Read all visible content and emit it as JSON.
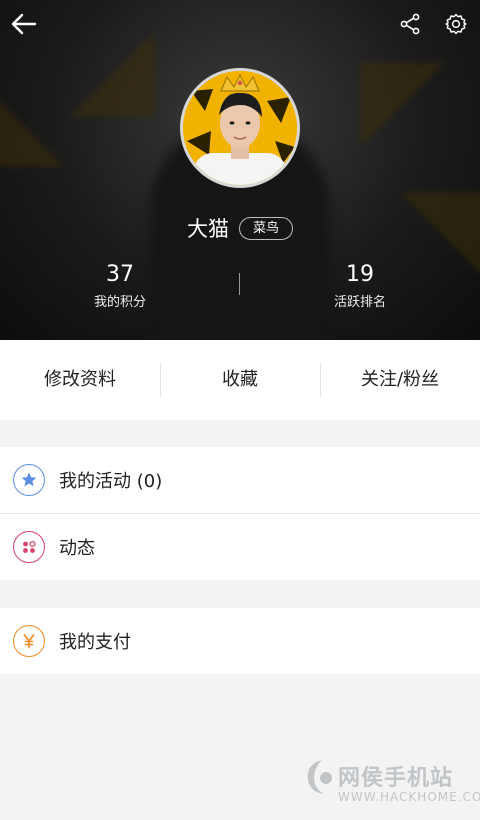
{
  "profile": {
    "username": "大猫",
    "level_badge": "菜鸟"
  },
  "stats": [
    {
      "value": "37",
      "label": "我的积分"
    },
    {
      "value": "19",
      "label": "活跃排名"
    }
  ],
  "tabs": [
    {
      "label": "修改资料"
    },
    {
      "label": "收藏"
    },
    {
      "label": "关注/粉丝"
    }
  ],
  "menu": [
    {
      "label": "我的活动 (0)",
      "icon": "star-icon",
      "color": "#5b8fe0"
    },
    {
      "label": "动态",
      "icon": "dots-icon",
      "color": "#d9436a"
    },
    {
      "label": "我的支付",
      "icon": "yen-icon",
      "color": "#ef8a22"
    }
  ],
  "watermark": {
    "brand": "网侯手机站",
    "url": "WWW.HACKHOME.COM"
  }
}
